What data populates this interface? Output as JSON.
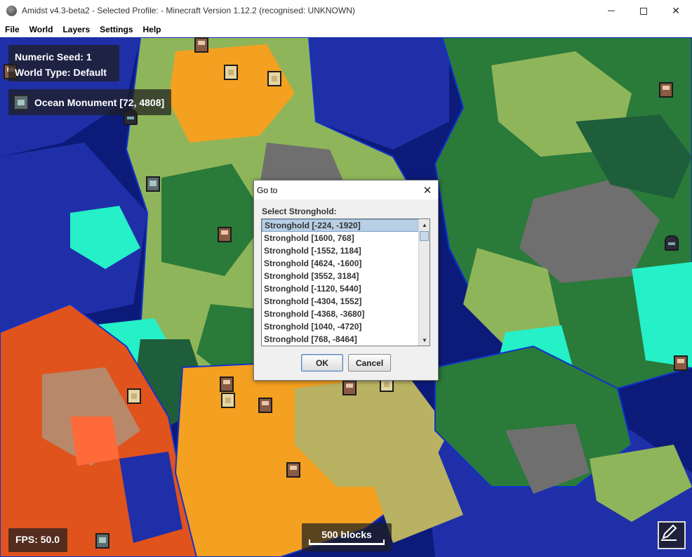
{
  "window": {
    "title": "Amidst v4.3-beta2 - Selected Profile:  - Minecraft Version 1.12.2 (recognised: UNKNOWN)",
    "minimize_glyph": "—",
    "maximize_glyph": "☐",
    "close_glyph": "✕"
  },
  "menu": {
    "items": [
      {
        "label": "File"
      },
      {
        "label": "World"
      },
      {
        "label": "Layers"
      },
      {
        "label": "Settings"
      },
      {
        "label": "Help"
      }
    ]
  },
  "overlay": {
    "seed_label": "Numeric Seed: 1",
    "world_type_label": "World Type: Default",
    "selected_structure": "Ocean Monument [72, 4808]",
    "fps": "FPS: 50.0",
    "scale": "500 blocks"
  },
  "dialog": {
    "title": "Go to",
    "close_glyph": "✕",
    "label": "Select Stronghold:",
    "items": [
      "Stronghold [-224, -1920]",
      "Stronghold [1600, 768]",
      "Stronghold [-1552, 1184]",
      "Stronghold [4624, -1600]",
      "Stronghold [3552, 3184]",
      "Stronghold [-1120, 5440]",
      "Stronghold [-4304, 1552]",
      "Stronghold [-4368, -3680]",
      "Stronghold [1040, -4720]",
      "Stronghold [768, -8464]"
    ],
    "selected_index": 0,
    "ok_label": "OK",
    "cancel_label": "Cancel"
  },
  "colors": {
    "deep_ocean": "#0c1b7a",
    "ocean": "#1f2fa8",
    "forest": "#2a7a3a",
    "dark_forest": "#1f5e3a",
    "plains": "#8fb55a",
    "savanna": "#b8b262",
    "mesa": "#e0531d",
    "desert": "#f4a020",
    "ice_plains": "#25f0c8",
    "mountains": "#6f6f6f",
    "river": "#1133cc",
    "beach": "#f2e08a"
  }
}
